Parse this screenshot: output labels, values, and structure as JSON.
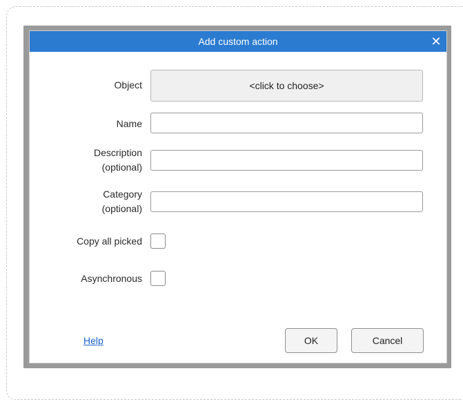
{
  "dialog": {
    "title": "Add custom action",
    "close_glyph": "✕",
    "object": {
      "label": "Object",
      "button_text": "<click to choose>"
    },
    "name": {
      "label": "Name",
      "value": ""
    },
    "description": {
      "label_line1": "Description",
      "label_line2": "(optional)",
      "value": ""
    },
    "category": {
      "label_line1": "Category",
      "label_line2": "(optional)",
      "value": ""
    },
    "copy_all_picked": {
      "label": "Copy all picked",
      "checked": false
    },
    "asynchronous": {
      "label": "Asynchronous",
      "checked": false
    },
    "help_link": "Help",
    "ok_label": "OK",
    "cancel_label": "Cancel"
  },
  "colors": {
    "titlebar": "#2b7bd1",
    "link": "#1a5fc8"
  }
}
